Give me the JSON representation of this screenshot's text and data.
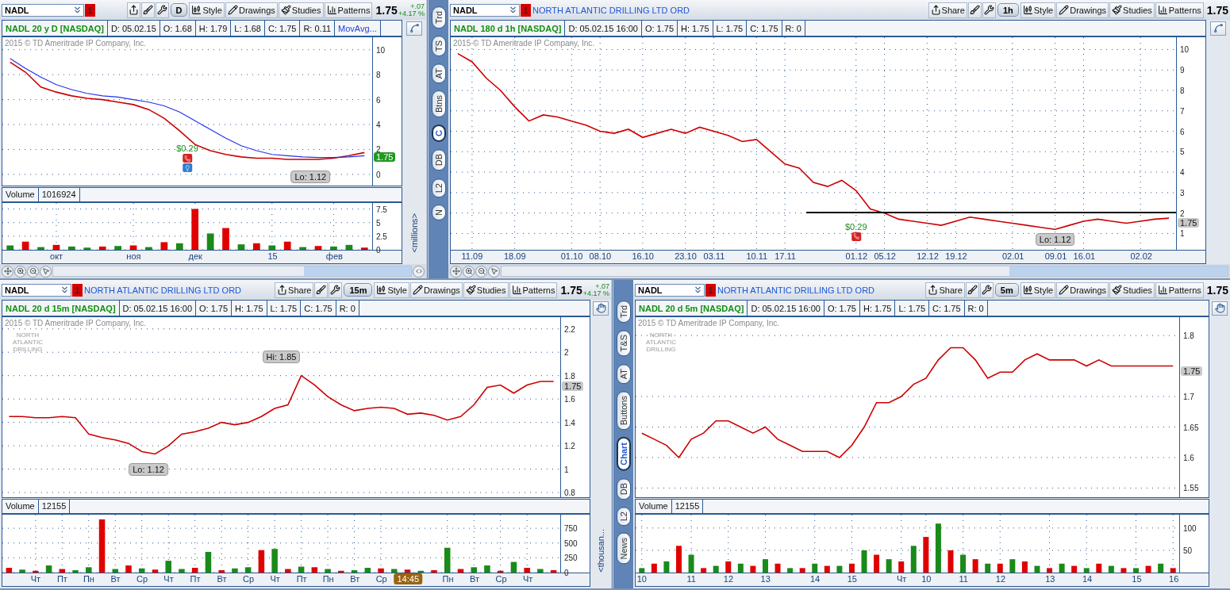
{
  "panels": [
    {
      "symbol": "NADL",
      "alert_count": "1",
      "toolbar": [
        {
          "kind": "share"
        },
        {
          "kind": "tools"
        },
        {
          "kind": "settings"
        },
        {
          "kind": "timeframe",
          "label": "D"
        },
        {
          "kind": "style",
          "label": "Style"
        },
        {
          "kind": "drawings",
          "label": "Drawings"
        },
        {
          "kind": "studies",
          "label": "Studies"
        },
        {
          "kind": "patterns",
          "label": "Patterns"
        }
      ],
      "price": "1.75",
      "change": {
        "abs": "+.07",
        "pct": "+4.17 %"
      },
      "info": {
        "title": "NADL 20 y D [NASDAQ]",
        "fields": [
          "D: 05.02.15",
          "O: 1.68",
          "H: 1.79",
          "L: 1.68",
          "C: 1.75",
          "R: 0.11"
        ],
        "study": "MovAvg..."
      },
      "price_pane": {
        "watermark": "2015 © TD Ameritrade IP Company, Inc.",
        "last_price": {
          "text": "1.75",
          "color": "#1f9a1f"
        },
        "news_marker": true,
        "chart_data": {
          "type": "line",
          "ylim": [
            -0.9,
            11
          ],
          "yticks": [
            0,
            2,
            4,
            6,
            8,
            10
          ],
          "grid": true,
          "series": [
            {
              "color": "#cc0000",
              "values": [
                9,
                8.2,
                7,
                6.6,
                6.3,
                6.1,
                6,
                5.8,
                5.6,
                5.2,
                4.5,
                3.5,
                2.4,
                1.9,
                1.6,
                1.4,
                1.3,
                1.3,
                1.2,
                1.2,
                1.2,
                1.3,
                1.5,
                1.75
              ]
            },
            {
              "color": "#2233ee",
              "values": [
                9.3,
                8.5,
                7.8,
                7.2,
                6.8,
                6.5,
                6.3,
                6.2,
                6,
                5.8,
                5.5,
                5,
                4.3,
                3.6,
                2.9,
                2.3,
                1.9,
                1.6,
                1.5,
                1.4,
                1.35,
                1.35,
                1.4,
                1.5
              ]
            }
          ],
          "annotations": [
            "$0.29",
            "Lo: 1.12"
          ]
        }
      },
      "volume": {
        "label": "Volume",
        "value": "1016924",
        "units": "<millions>",
        "chart_data": {
          "type": "bar",
          "ylim": [
            0,
            8.6
          ],
          "yticks": [
            0,
            2.5,
            5,
            7.5
          ],
          "grid": true,
          "categories": [
            null,
            null,
            null,
            "окт",
            null,
            null,
            null,
            null,
            "ноя",
            null,
            null,
            null,
            "дек",
            null,
            null,
            null,
            null,
            "15",
            null,
            null,
            null,
            "фев",
            null,
            null
          ],
          "series": [
            {
              "color": "#1a8a1a",
              "values": [
                0.8,
                null,
                0.5,
                null,
                0.6,
                0.4,
                null,
                0.7,
                null,
                0.5,
                null,
                1.2,
                null,
                3.0,
                null,
                1.0,
                null,
                0.8,
                null,
                0.5,
                null,
                0.6,
                0.9,
                null
              ]
            },
            {
              "color": "#e00000",
              "values": [
                null,
                1.5,
                null,
                0.9,
                null,
                null,
                0.6,
                null,
                0.8,
                null,
                1.4,
                null,
                7.5,
                null,
                4.0,
                null,
                1.2,
                null,
                1.5,
                null,
                0.7,
                null,
                null,
                0.4
              ]
            }
          ]
        }
      },
      "navigator": true
    },
    {
      "symbol": "NADL",
      "alert_count": "1",
      "company": "NORTH ATLANTIC DRILLING LTD ORD",
      "toolbar": [
        {
          "kind": "share",
          "label": "Share"
        },
        {
          "kind": "tools"
        },
        {
          "kind": "settings"
        },
        {
          "kind": "timeframe",
          "label": "1h"
        },
        {
          "kind": "style",
          "label": "Style"
        },
        {
          "kind": "drawings",
          "label": "Drawings"
        },
        {
          "kind": "studies",
          "label": "Studies"
        },
        {
          "kind": "patterns",
          "label": "Patterns"
        }
      ],
      "price": "1.75",
      "info": {
        "title": "NADL 180 d 1h [NASDAQ]",
        "fields": [
          "D: 05.02.15 16:00",
          "O: 1.75",
          "H: 1.75",
          "L: 1.75",
          "C: 1.75",
          "R: 0"
        ]
      },
      "price_pane": {
        "watermark": "2015 © TD Ameritrade IP Company, Inc.",
        "last_price": {
          "text": "1.75",
          "color": "#c8c8c8"
        },
        "chart_data": {
          "type": "line",
          "ylim": [
            0.2,
            10.6
          ],
          "yticks": [
            1,
            2,
            3,
            4,
            5,
            6,
            7,
            8,
            9,
            10
          ],
          "grid": true,
          "categories": [
            null,
            "11.09",
            null,
            null,
            "18.09",
            null,
            null,
            null,
            "01.10",
            null,
            "08.10",
            null,
            null,
            "16.10",
            null,
            null,
            "23.10",
            null,
            "03.11",
            null,
            null,
            "10.11",
            null,
            "17.11",
            null,
            null,
            null,
            null,
            "01.12",
            null,
            "05.12",
            null,
            null,
            "12.12",
            null,
            "19.12",
            null,
            null,
            null,
            "02.01",
            null,
            null,
            "09.01",
            null,
            "16.01",
            null,
            null,
            null,
            "02.02",
            null,
            null
          ],
          "series": [
            {
              "color": "#cc0000",
              "values": [
                9.8,
                9.4,
                8.6,
                8,
                7.2,
                6.5,
                6.8,
                6.7,
                6.5,
                6.3,
                6,
                5.9,
                6.1,
                5.7,
                5.9,
                6.1,
                5.9,
                6.2,
                6,
                5.8,
                5.5,
                5.6,
                5,
                4.4,
                4.2,
                3.5,
                3.3,
                3.6,
                3.1,
                2.2,
                2,
                1.7,
                1.6,
                1.5,
                1.4,
                1.6,
                1.8,
                1.7,
                1.6,
                1.5,
                1.4,
                1.3,
                1.2,
                1.4,
                1.6,
                1.7,
                1.6,
                1.5,
                1.6,
                1.7,
                1.75
              ]
            }
          ],
          "ref_lines": [
            {
              "axis": "y",
              "value": 2.05
            }
          ],
          "annotations": [
            "$0.29",
            "Lo: 1.12"
          ]
        }
      },
      "navigator": true
    },
    {
      "symbol": "NADL",
      "alert_count": "1",
      "company": "NORTH ATLANTIC DRILLING LTD ORD",
      "toolbar": [
        {
          "kind": "share",
          "label": "Share"
        },
        {
          "kind": "tools"
        },
        {
          "kind": "settings"
        },
        {
          "kind": "timeframe",
          "label": "15m"
        },
        {
          "kind": "style",
          "label": "Style"
        },
        {
          "kind": "drawings",
          "label": "Drawings"
        },
        {
          "kind": "studies",
          "label": "Studies"
        },
        {
          "kind": "patterns",
          "label": "Patterns"
        }
      ],
      "price": "1.75",
      "change": {
        "abs": "+.07",
        "pct": "+4.17 %"
      },
      "info": {
        "title": "NADL 20 d 15m [NASDAQ]",
        "fields": [
          "D: 05.02.15 16:00",
          "O: 1.75",
          "H: 1.75",
          "L: 1.75",
          "C: 1.75",
          "R: 0"
        ]
      },
      "price_pane": {
        "watermark": "2015 © TD Ameritrade IP Company, Inc.",
        "logo": "NORTH ATLANTIC DRILLING",
        "last_price": {
          "text": "1.75",
          "color": "#c8c8c8"
        },
        "chart_data": {
          "type": "line",
          "ylim": [
            0.76,
            2.3
          ],
          "yticks": [
            0.8,
            1,
            1.2,
            1.4,
            1.6,
            1.8,
            2,
            2.2
          ],
          "grid": true,
          "series": [
            {
              "color": "#cc0000",
              "values": [
                1.45,
                1.45,
                1.44,
                1.44,
                1.45,
                1.44,
                1.3,
                1.27,
                1.25,
                1.22,
                1.15,
                1.13,
                1.2,
                1.3,
                1.32,
                1.35,
                1.4,
                1.38,
                1.4,
                1.45,
                1.52,
                1.55,
                1.8,
                1.72,
                1.62,
                1.55,
                1.5,
                1.52,
                1.53,
                1.52,
                1.47,
                1.48,
                1.46,
                1.42,
                1.45,
                1.55,
                1.7,
                1.72,
                1.65,
                1.72,
                1.75,
                1.75
              ]
            }
          ],
          "annotations": [
            "Lo: 1.12",
            "Hi: 1.85"
          ]
        }
      },
      "volume": {
        "label": "Volume",
        "value": "12155",
        "units": "<thousan...",
        "chart_data": {
          "type": "bar",
          "ylim": [
            0,
            980
          ],
          "yticks": [
            0,
            250,
            500,
            750
          ],
          "grid": true,
          "categories": [
            null,
            null,
            "Чт",
            null,
            "Пт",
            null,
            "Пн",
            null,
            "Вт",
            null,
            "Ср",
            null,
            "Чт",
            null,
            "Пт",
            null,
            "Вт",
            null,
            "Ср",
            null,
            "Чт",
            null,
            "Пт",
            null,
            "Пн",
            null,
            "Вт",
            null,
            "Ср",
            null,
            null,
            null,
            null,
            "Пн",
            null,
            "Вт",
            null,
            "Ср",
            null,
            "Чт",
            null,
            null
          ],
          "series": [
            {
              "color": "#1a8a1a",
              "values": [
                null,
                50,
                null,
                120,
                null,
                40,
                90,
                null,
                60,
                null,
                70,
                null,
                200,
                60,
                null,
                350,
                null,
                70,
                90,
                null,
                400,
                null,
                100,
                null,
                60,
                null,
                40,
                80,
                null,
                60,
                null,
                30,
                null,
                420,
                null,
                90,
                120,
                null,
                180,
                null,
                60,
                null
              ]
            },
            {
              "color": "#e00000",
              "values": [
                80,
                null,
                30,
                null,
                60,
                null,
                null,
                900,
                null,
                120,
                null,
                50,
                null,
                null,
                80,
                null,
                40,
                null,
                null,
                380,
                null,
                60,
                null,
                90,
                null,
                30,
                null,
                null,
                70,
                null,
                50,
                null,
                40,
                null,
                60,
                null,
                null,
                30,
                null,
                80,
                null,
                40
              ]
            }
          ],
          "annotations": [
            "14:45"
          ]
        }
      }
    },
    {
      "symbol": "NADL",
      "alert_count": "1",
      "company": "NORTH ATLANTIC DRILLING LTD ORD",
      "toolbar": [
        {
          "kind": "share",
          "label": "Share"
        },
        {
          "kind": "tools"
        },
        {
          "kind": "settings"
        },
        {
          "kind": "timeframe",
          "label": "5m"
        },
        {
          "kind": "style",
          "label": "Style"
        },
        {
          "kind": "drawings",
          "label": "Drawings"
        },
        {
          "kind": "studies",
          "label": "Studies"
        },
        {
          "kind": "patterns",
          "label": "Patterns"
        }
      ],
      "price": "1.75",
      "info": {
        "title": "NADL 20 d 5m [NASDAQ]",
        "fields": [
          "D: 05.02.15 16:00",
          "O: 1.75",
          "H: 1.75",
          "L: 1.75",
          "C: 1.75",
          "R: 0"
        ]
      },
      "price_pane": {
        "watermark": "2015 © TD Ameritrade IP Company, Inc.",
        "logo": "NORTH ATLANTIC DRILLING",
        "last_price": {
          "text": "1.75",
          "color": "#c8c8c8"
        },
        "chart_data": {
          "type": "line",
          "ylim": [
            1.535,
            1.83
          ],
          "yticks": [
            1.55,
            1.6,
            1.65,
            1.7,
            1.8
          ],
          "grid": true,
          "series": [
            {
              "color": "#cc0000",
              "values": [
                1.64,
                1.63,
                1.62,
                1.6,
                1.63,
                1.64,
                1.66,
                1.66,
                1.65,
                1.64,
                1.65,
                1.63,
                1.62,
                1.61,
                1.61,
                1.61,
                1.6,
                1.62,
                1.65,
                1.69,
                1.69,
                1.7,
                1.72,
                1.73,
                1.76,
                1.78,
                1.78,
                1.76,
                1.73,
                1.74,
                1.74,
                1.76,
                1.77,
                1.76,
                1.76,
                1.76,
                1.75,
                1.76,
                1.75,
                1.75,
                1.75,
                1.75,
                1.75,
                1.75
              ]
            }
          ]
        }
      },
      "volume": {
        "label": "Volume",
        "value": "12155",
        "chart_data": {
          "type": "bar",
          "ylim": [
            0,
            130
          ],
          "yticks": [
            50,
            100
          ],
          "grid": true,
          "categories": [
            "10",
            null,
            null,
            null,
            "11",
            null,
            null,
            "12",
            null,
            null,
            "13",
            null,
            null,
            null,
            "14",
            null,
            null,
            "15",
            null,
            null,
            null,
            "Чт",
            null,
            "10",
            null,
            null,
            "11",
            null,
            null,
            "12",
            null,
            null,
            null,
            "13",
            null,
            null,
            "14",
            null,
            null,
            null,
            "15",
            null,
            null,
            "16"
          ],
          "series": [
            {
              "color": "#1a8a1a",
              "values": [
                10,
                null,
                25,
                null,
                40,
                null,
                15,
                null,
                20,
                null,
                30,
                null,
                10,
                null,
                20,
                null,
                15,
                null,
                50,
                null,
                30,
                null,
                60,
                null,
                110,
                null,
                40,
                null,
                20,
                null,
                30,
                null,
                15,
                null,
                20,
                null,
                10,
                null,
                15,
                null,
                10,
                null,
                20,
                null
              ]
            },
            {
              "color": "#e00000",
              "values": [
                null,
                20,
                null,
                60,
                null,
                10,
                null,
                25,
                null,
                15,
                null,
                20,
                null,
                10,
                null,
                15,
                null,
                20,
                null,
                40,
                null,
                25,
                null,
                80,
                null,
                50,
                null,
                30,
                null,
                20,
                null,
                25,
                null,
                10,
                null,
                15,
                null,
                20,
                null,
                10,
                null,
                15,
                null,
                10
              ]
            }
          ]
        }
      }
    }
  ],
  "side_panels": [
    {
      "tabs": [
        {
          "label": "Trd",
          "selected": false
        },
        {
          "label": "TS",
          "selected": false
        },
        {
          "label": "AT",
          "selected": false
        },
        {
          "label": "Btns",
          "selected": false
        },
        {
          "label": "C",
          "selected": true
        },
        {
          "label": "DB",
          "selected": false
        },
        {
          "label": "L2",
          "selected": false
        },
        {
          "label": "N",
          "selected": false
        }
      ]
    },
    {
      "tabs": [
        {
          "label": "Trd",
          "selected": false
        },
        {
          "label": "T&S",
          "selected": false
        },
        {
          "label": "AT",
          "selected": false
        },
        {
          "label": "Buttons",
          "selected": false
        },
        {
          "label": "Chart",
          "selected": true
        },
        {
          "label": "DB",
          "selected": false
        },
        {
          "label": "L2",
          "selected": false
        },
        {
          "label": "News",
          "selected": false
        }
      ]
    }
  ]
}
